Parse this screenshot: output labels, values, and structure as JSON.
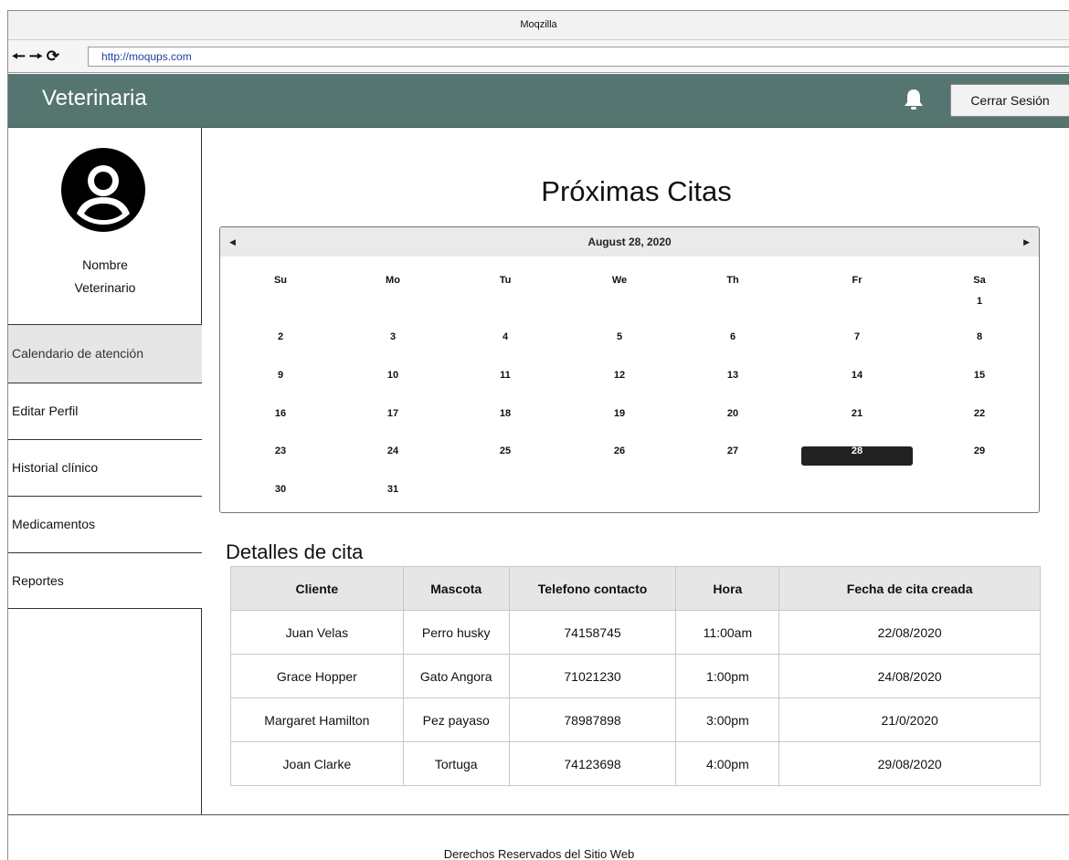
{
  "browser": {
    "window_title": "Moqzilla",
    "url": "http://moqups.com"
  },
  "header": {
    "brand": "Veterinaria",
    "logout_label": "Cerrar Sesión",
    "icon": "bell-icon"
  },
  "sidebar": {
    "name_line1": "Nombre",
    "name_line2": "Veterinario",
    "items": [
      {
        "label": "Calendario de atención",
        "active": true
      },
      {
        "label": "Editar Perfil",
        "active": false
      },
      {
        "label": "Historial clínico",
        "active": false
      },
      {
        "label": "Medicamentos",
        "active": false
      },
      {
        "label": "Reportes",
        "active": false
      }
    ]
  },
  "main": {
    "title": "Próximas Citas",
    "details_title": "Detalles de cita"
  },
  "calendar": {
    "month_label": "August 28, 2020",
    "weekdays": [
      "Su",
      "Mo",
      "Tu",
      "We",
      "Th",
      "Fr",
      "Sa"
    ],
    "selected_day": 28,
    "weeks": [
      [
        "",
        "",
        "",
        "",
        "",
        "",
        "1"
      ],
      [
        "2",
        "3",
        "4",
        "5",
        "6",
        "7",
        "8"
      ],
      [
        "9",
        "10",
        "11",
        "12",
        "13",
        "14",
        "15"
      ],
      [
        "16",
        "17",
        "18",
        "19",
        "20",
        "21",
        "22"
      ],
      [
        "23",
        "24",
        "25",
        "26",
        "27",
        "28",
        "29"
      ],
      [
        "30",
        "31",
        "",
        "",
        "",
        "",
        ""
      ]
    ]
  },
  "table": {
    "headers": [
      "Cliente",
      "Mascota",
      "Telefono contacto",
      "Hora",
      "Fecha de cita creada"
    ],
    "rows": [
      [
        "Juan Velas",
        "Perro husky",
        "74158745",
        "11:00am",
        "22/08/2020"
      ],
      [
        "Grace Hopper",
        "Gato Angora",
        "71021230",
        "1:00pm",
        "24/08/2020"
      ],
      [
        "Margaret Hamilton",
        "Pez payaso",
        "78987898",
        "3:00pm",
        "21/0/2020"
      ],
      [
        "Joan Clarke",
        "Tortuga",
        "74123698",
        "4:00pm",
        "29/08/2020"
      ]
    ]
  },
  "footer": {
    "text": "Derechos Reservados del Sitio Web"
  }
}
